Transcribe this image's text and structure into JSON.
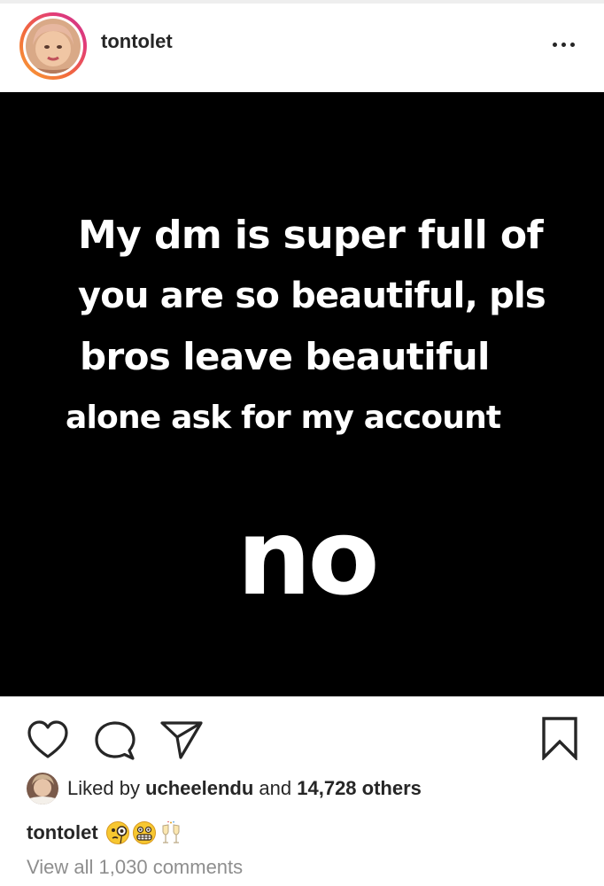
{
  "post": {
    "username": "tontolet",
    "image_text": {
      "line1": "My dm is super full  of",
      "line2": "you are so beautiful, pls",
      "line3": "bros leave beautiful",
      "line4": "alone ask for my account",
      "big": "no"
    }
  },
  "likes": {
    "prefix": "Liked by ",
    "liked_by_user": "ucheelendu",
    "middle": " and ",
    "count_text": "14,728 others"
  },
  "caption": {
    "username": "tontolet",
    "emojis": [
      "monocle-face-emoji",
      "grimacing-face-emoji",
      "clinking-glasses-emoji"
    ]
  },
  "comments": {
    "view_all_label": "View all 1,030 comments"
  },
  "icons": {
    "more": "more-options-icon",
    "like": "heart-icon",
    "comment": "comment-bubble-icon",
    "share": "paper-plane-icon",
    "save": "bookmark-icon"
  },
  "colors": {
    "story_ring_start": "#f9a135",
    "story_ring_end": "#c8368b",
    "text_primary": "#262626",
    "text_secondary": "#8e8e8e",
    "post_background": "#000000",
    "post_text": "#ffffff"
  }
}
